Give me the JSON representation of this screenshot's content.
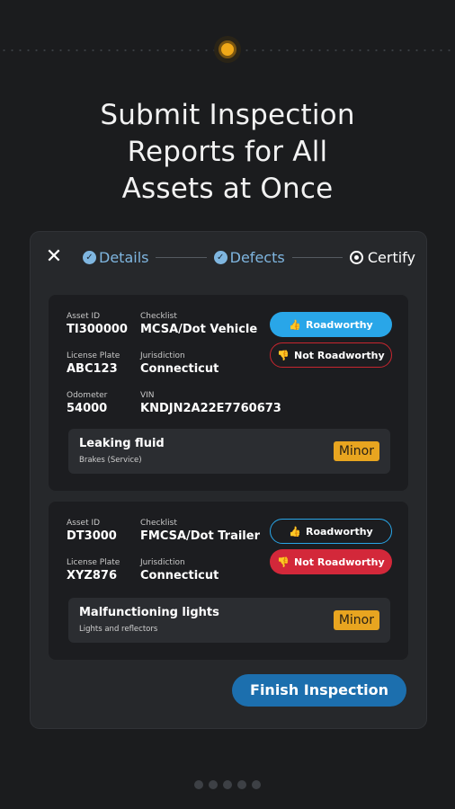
{
  "headline": [
    "Submit Inspection",
    "Reports for All",
    "Assets at Once"
  ],
  "stepper": {
    "steps": [
      {
        "label": "Details",
        "state": "done"
      },
      {
        "label": "Defects",
        "state": "done"
      },
      {
        "label": "Certify",
        "state": "active"
      }
    ]
  },
  "assets": [
    {
      "asset_id_label": "Asset ID",
      "asset_id": "TI300000",
      "checklist_label": "Checklist",
      "checklist": "MCSA/Dot Vehicle",
      "plate_label": "License Plate",
      "plate": "ABC123",
      "jurisdiction_label": "Jurisdiction",
      "jurisdiction": "Connecticut",
      "odometer_label": "Odometer",
      "odometer": "54000",
      "vin_label": "VIN",
      "vin": "KNDJN2A22E7760673",
      "roadworthy_label": "Roadworthy",
      "not_roadworthy_label": "Not Roadworthy",
      "selected": "Roadworthy",
      "defect": {
        "title": "Leaking fluid",
        "sub": "Brakes (Service)",
        "severity": "Minor"
      }
    },
    {
      "asset_id_label": "Asset ID",
      "asset_id": "DT3000",
      "checklist_label": "Checklist",
      "checklist": "FMCSA/Dot Trailer",
      "plate_label": "License Plate",
      "plate": "XYZ876",
      "jurisdiction_label": "Jurisdiction",
      "jurisdiction": "Connecticut",
      "roadworthy_label": "Roadworthy",
      "not_roadworthy_label": "Not Roadworthy",
      "selected": "Not Roadworthy",
      "defect": {
        "title": "Malfunctioning lights",
        "sub": "Lights and reflectors",
        "severity": "Minor"
      }
    }
  ],
  "finish_label": "Finish Inspection",
  "colors": {
    "accent_blue": "#29a6e8",
    "danger_red": "#d3283a",
    "severity_amber": "#e8a520",
    "finish_blue": "#1c6fae"
  },
  "icons": {
    "close": "close-icon",
    "check": "check-circle-icon",
    "radio": "radio-icon",
    "thumb_up": "thumbs-up-icon",
    "thumb_down": "thumbs-down-icon"
  }
}
